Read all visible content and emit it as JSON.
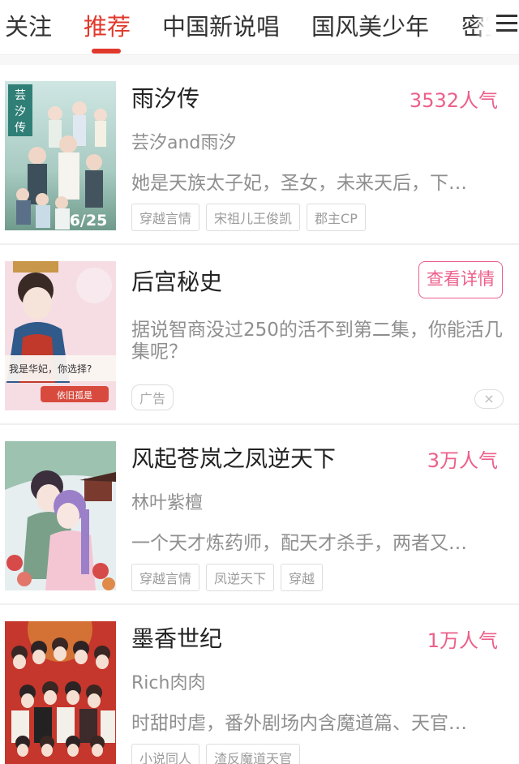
{
  "tabs": [
    {
      "label": "关注",
      "active": false
    },
    {
      "label": "推荐",
      "active": true
    },
    {
      "label": "中国新说唱",
      "active": false
    },
    {
      "label": "国风美少年",
      "active": false
    },
    {
      "label": "密室",
      "active": false
    }
  ],
  "icons": {
    "menu": "hamburger-menu-icon",
    "close": "close-icon"
  },
  "colors": {
    "accent": "#e0392b",
    "pink": "#ec5f8a",
    "gray_text": "#8f8f8f"
  },
  "cards": [
    {
      "title": "雨汐传",
      "popularity": "3532人气",
      "author": "芸汐and雨汐",
      "description": "她是天族太子妃，圣女，未来天后，下…",
      "tags": [
        "穿越言情",
        "宋祖儿王俊凯",
        "郡主CP"
      ],
      "cover_text": "芸汐传",
      "cover_date": "6/25"
    },
    {
      "title": "后宫秘史",
      "action_label": "查看详情",
      "description": "据说智商没过250的活不到第二集，你能活几集呢？",
      "ad_label": "广告",
      "close_glyph": "×",
      "cover_caption": "我是华妃，你选择?",
      "cover_button": "依旧孤是"
    },
    {
      "title": "风起苍岚之凤逆天下",
      "popularity": "3万人气",
      "author": "林叶紫檀",
      "description": "一个天才炼药师，配天才杀手，两者又…",
      "tags": [
        "穿越言情",
        "凤逆天下",
        "穿越"
      ]
    },
    {
      "title": "墨香世纪",
      "popularity": "1万人气",
      "author": "Rich肉肉",
      "description": "时甜时虐，番外剧场内含魔道篇、天官…",
      "tags": [
        "小说同人",
        "渣反魔道天官"
      ]
    }
  ]
}
